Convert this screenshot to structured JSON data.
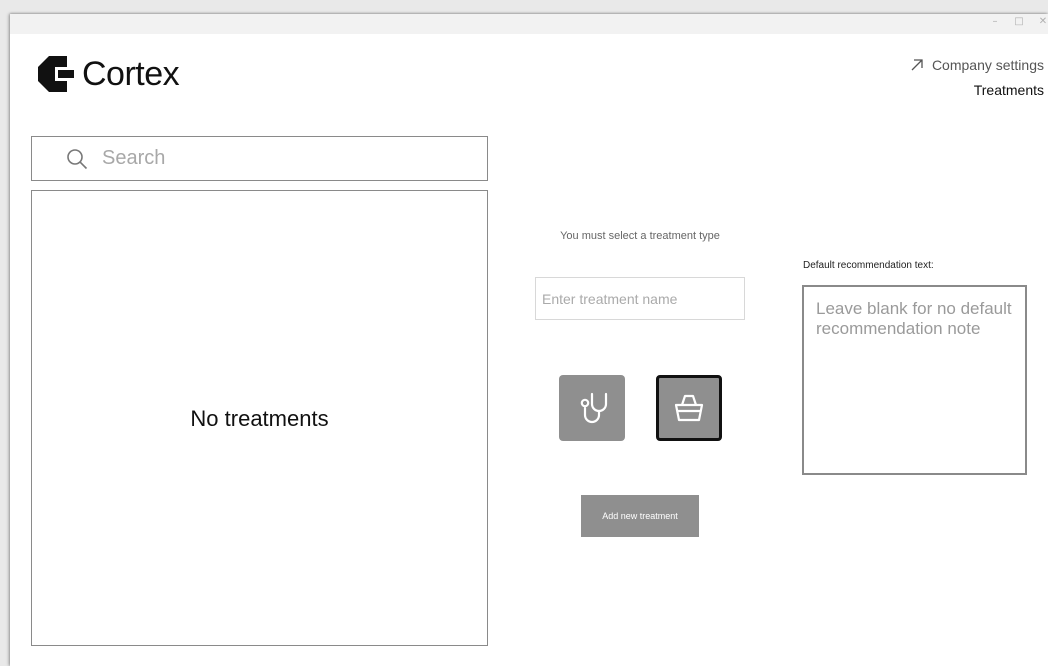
{
  "window": {
    "controls": [
      "–",
      "□",
      "✕"
    ]
  },
  "app": {
    "logo_text": "Cortex"
  },
  "nav": {
    "company_settings": "Company settings",
    "treatments": "Treatments"
  },
  "search": {
    "placeholder": "Search"
  },
  "list": {
    "empty_text": "No treatments"
  },
  "form": {
    "warning": "You must select a treatment type",
    "name_placeholder": "Enter treatment name",
    "types": [
      {
        "icon": "stethoscope-icon",
        "selected": false
      },
      {
        "icon": "basket-icon",
        "selected": true
      }
    ],
    "add_button": "Add new treatment",
    "recommendation_label": "Default recommendation text:",
    "recommendation_placeholder": "Leave blank for no default recommendation note"
  },
  "colors": {
    "button_gray": "#8f8f8f",
    "border_gray": "#8a8a8a",
    "text_dark": "#111111"
  }
}
